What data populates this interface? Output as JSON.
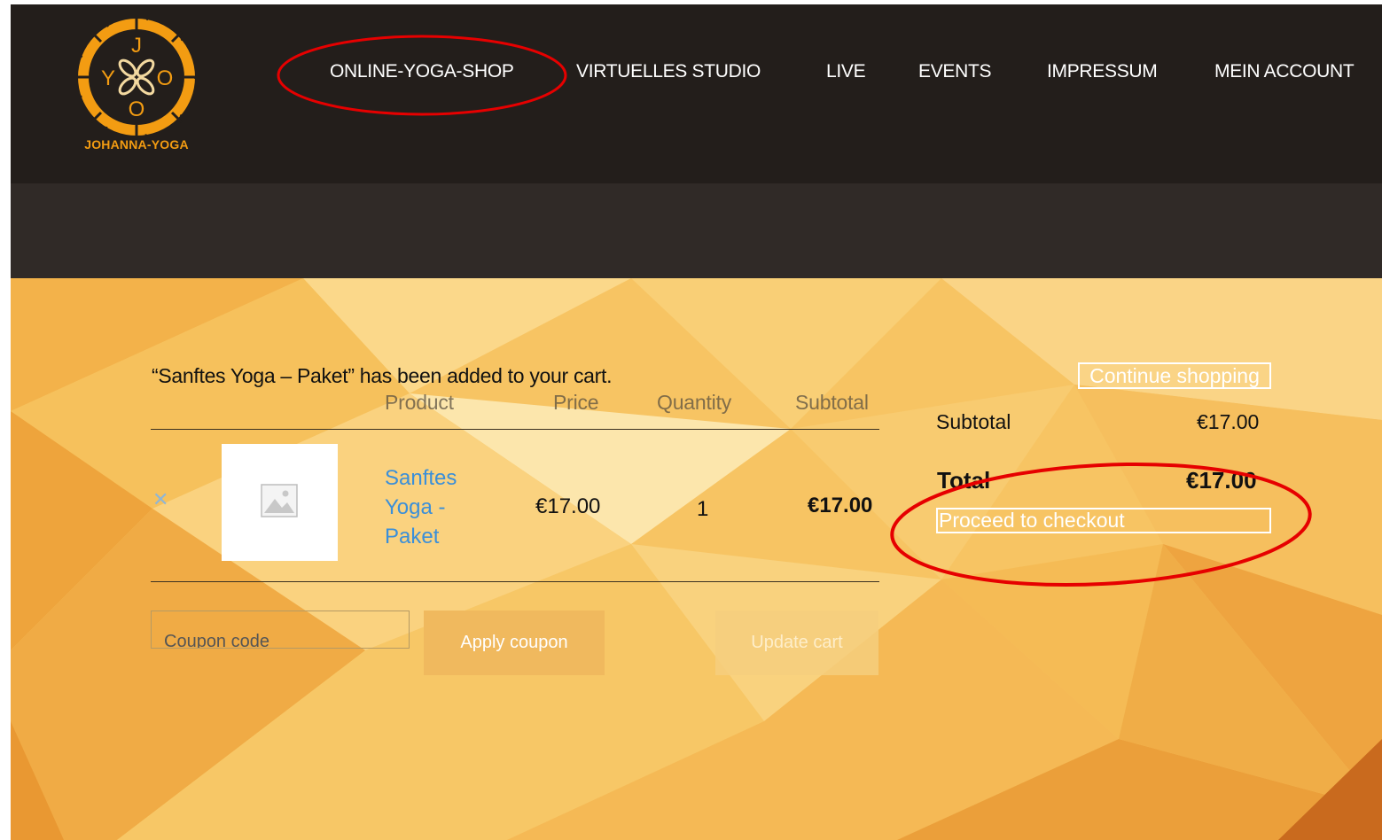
{
  "brand": {
    "logo_text": "JOHANNA-YOGA",
    "logo_letters": {
      "top": "J",
      "left": "Y",
      "right": "O",
      "bottom": "O"
    },
    "accent_color": "#f39c12"
  },
  "nav": {
    "items": [
      {
        "label": "ONLINE-YOGA-SHOP"
      },
      {
        "label": "VIRTUELLES STUDIO"
      },
      {
        "label": "LIVE"
      },
      {
        "label": "EVENTS"
      },
      {
        "label": "IMPRESSUM"
      },
      {
        "label": "MEIN ACCOUNT"
      }
    ]
  },
  "cart": {
    "message": "“Sanftes Yoga – Paket” has been added to your cart.",
    "columns": {
      "product": "Product",
      "price": "Price",
      "quantity": "Quantity",
      "subtotal": "Subtotal"
    },
    "row": {
      "remove_icon": "close-icon",
      "product": "Sanftes Yoga - Paket",
      "price": "€17.00",
      "quantity": "1",
      "subtotal": "€17.00"
    },
    "coupon_placeholder": "Coupon code",
    "apply_coupon": "Apply coupon",
    "update_cart": "Update cart"
  },
  "summary": {
    "continue_shopping": "Continue shopping",
    "subtotal_label": "Subtotal",
    "subtotal_value": "€17.00",
    "total_label": "Total",
    "total_value": "€17.00",
    "checkout": "Proceed to checkout"
  },
  "annotation_color": "#e60000"
}
